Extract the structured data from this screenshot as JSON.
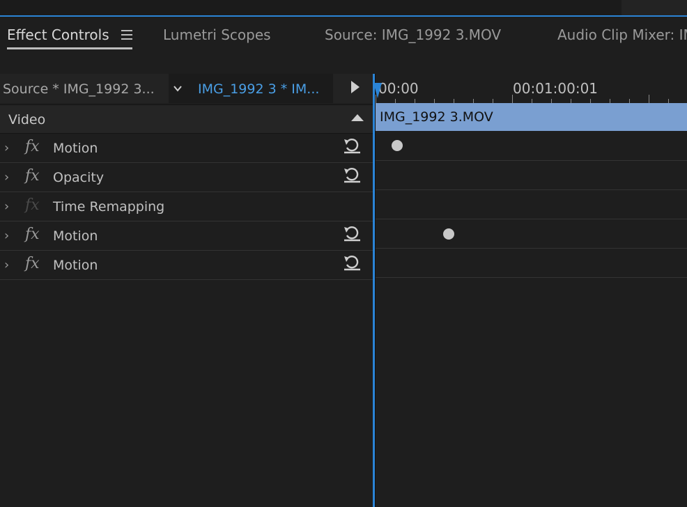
{
  "tabs": [
    {
      "label": "Effect Controls",
      "active": true
    },
    {
      "label": "Lumetri Scopes",
      "active": false
    },
    {
      "label": "Source: IMG_1992 3.MOV",
      "active": false
    },
    {
      "label": "Audio Clip Mixer: IM",
      "active": false
    }
  ],
  "header": {
    "source_tab": "Source * IMG_1992 3...",
    "clip_tab": "IMG_1992 3 * IM..."
  },
  "video_section": {
    "label": "Video"
  },
  "effects": [
    {
      "name": "Motion",
      "enabled": true,
      "reset": true
    },
    {
      "name": "Opacity",
      "enabled": true,
      "reset": true
    },
    {
      "name": "Time Remapping",
      "enabled": false,
      "reset": false
    },
    {
      "name": "Motion",
      "enabled": true,
      "reset": true
    },
    {
      "name": "Motion",
      "enabled": true,
      "reset": true
    }
  ],
  "fx_glyph": "fx",
  "timeline": {
    "ruler_start": "00:00",
    "ruler_mark": "00:01:00:01",
    "clip_name": "IMG_1992 3.MOV"
  },
  "colors": {
    "accent": "#2b84d6",
    "clip_bar": "#7a9fd1",
    "background": "#1e1e1e"
  }
}
